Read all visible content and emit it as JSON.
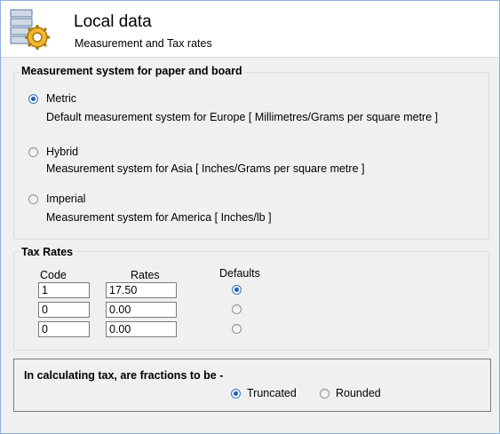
{
  "header": {
    "title": "Local data",
    "subtitle": "Measurement and Tax rates",
    "icon": "database-gear-icon"
  },
  "measurement": {
    "title": "Measurement system for paper and board",
    "options": [
      {
        "label": "Metric",
        "description": "Default measurement system for Europe [ Millimetres/Grams per square metre ]",
        "selected": true
      },
      {
        "label": "Hybrid",
        "description": "Measurement system for Asia [ Inches/Grams per square metre ]",
        "selected": false
      },
      {
        "label": "Imperial",
        "description": "Measurement system for America [ Inches/lb ]",
        "selected": false
      }
    ]
  },
  "tax": {
    "title": "Tax Rates",
    "headers": {
      "code": "Code",
      "rates": "Rates",
      "defaults": "Defaults"
    },
    "rows": [
      {
        "code": "1",
        "rate": "17.50",
        "default": true
      },
      {
        "code": "0",
        "rate": "0.00",
        "default": false
      },
      {
        "code": "0",
        "rate": "0.00",
        "default": false
      }
    ]
  },
  "calc": {
    "question": "In calculating tax, are fractions to be -",
    "options": [
      {
        "label": "Truncated",
        "selected": true
      },
      {
        "label": "Rounded",
        "selected": false
      }
    ]
  }
}
